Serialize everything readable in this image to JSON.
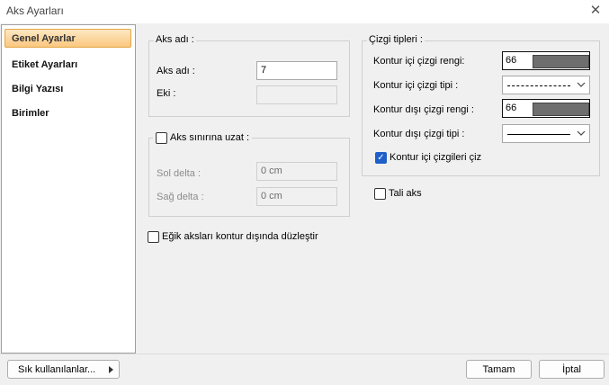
{
  "window": {
    "title": "Aks Ayarları",
    "close": "✕"
  },
  "sidebar": {
    "items": [
      {
        "label": "Genel Ayarlar",
        "selected": true
      },
      {
        "label": "Etiket Ayarları"
      },
      {
        "label": "Bilgi Yazısı"
      },
      {
        "label": "Birimler"
      }
    ]
  },
  "aks_adi_group": {
    "title": "Aks adı :",
    "name_label": "Aks adı :",
    "name_value": "7",
    "ek_label": "Eki :",
    "ek_value": ""
  },
  "aks_sinir": {
    "title": "Aks sınırına uzat :",
    "checked": false,
    "sol_label": "Sol delta :",
    "sol_value": "0 cm",
    "sag_label": "Sağ delta :",
    "sag_value": "0 cm"
  },
  "egik": {
    "label": "Eğik aksları kontur dışında düzleştir",
    "checked": false
  },
  "cizgi": {
    "title": "Çizgi tipleri :",
    "ic_renk_label": "Kontur içi çizgi rengi:",
    "ic_renk_value": "66",
    "ic_tip_label": "Kontur içi çizgi tipi :",
    "dis_renk_label": "Kontur dışı çizgi rengi :",
    "dis_renk_value": "66",
    "dis_tip_label": "Kontur dışı çizgi tipi :",
    "ciz_label": "Kontur içi çizgileri çiz",
    "ciz_checked": true,
    "swatch_color": "#6e6e6e"
  },
  "tali": {
    "label": "Tali aks",
    "checked": false
  },
  "footer": {
    "sik_label": "Sık kullanılanlar...",
    "tamam_label": "Tamam",
    "iptal_label": "İptal"
  }
}
